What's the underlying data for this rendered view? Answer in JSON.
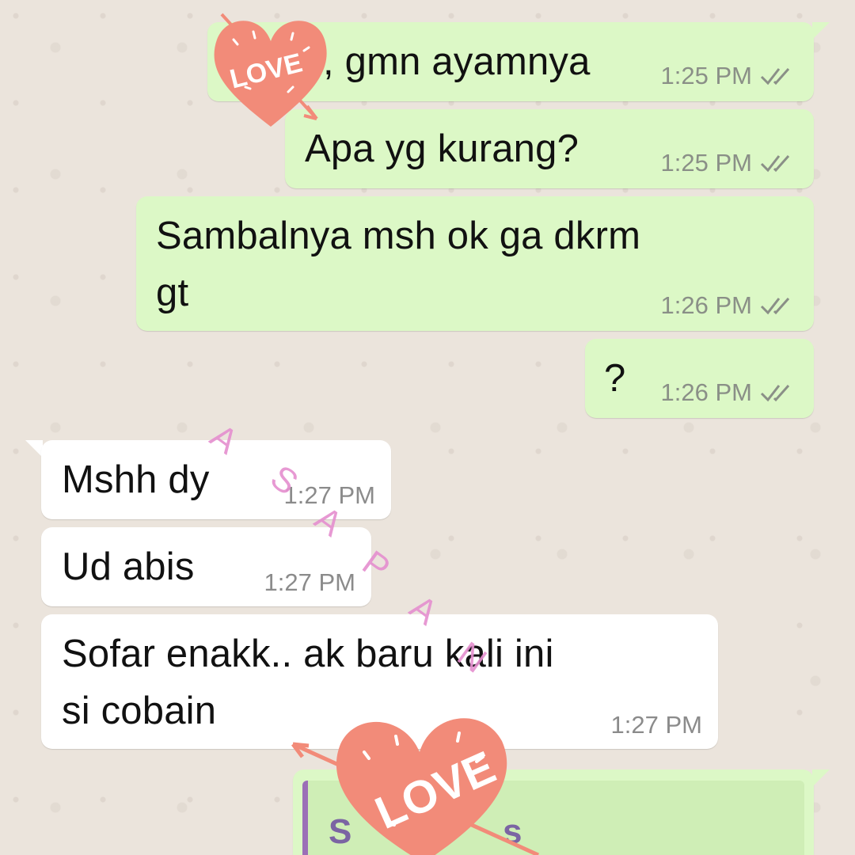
{
  "messages": [
    {
      "text": ", gmn ayamnya",
      "time": "1:25 PM",
      "direction": "outgoing",
      "ticks": "double-check-icon"
    },
    {
      "text": "Apa yg kurang?",
      "time": "1:25 PM",
      "direction": "outgoing",
      "ticks": "double-check-icon"
    },
    {
      "text_line1": "Sambalnya msh ok ga dkrm",
      "text_line2": "gt",
      "time": "1:26 PM",
      "direction": "outgoing",
      "ticks": "double-check-icon"
    },
    {
      "text": "?",
      "time": "1:26 PM",
      "direction": "outgoing",
      "ticks": "double-check-icon"
    },
    {
      "text": "Mshh dy",
      "time": "1:27 PM",
      "direction": "incoming"
    },
    {
      "text": "Ud abis",
      "time": "1:27 PM",
      "direction": "incoming"
    },
    {
      "text_line1": "Sofar enakk.. ak baru kali ini",
      "text_line2": "si cobain",
      "time": "1:27 PM",
      "direction": "incoming"
    }
  ],
  "quoted_partial": {
    "left": "S",
    "right": "s"
  },
  "stickers": [
    {
      "label": "LOVE",
      "icon": "heart-love-sticker-icon"
    },
    {
      "label": "LOVE",
      "icon": "heart-love-sticker-icon"
    }
  ],
  "watermark": [
    "A",
    "S",
    "A",
    "P",
    "A",
    "N"
  ],
  "colors": {
    "outgoing_bubble": "#dcf8c6",
    "incoming_bubble": "#ffffff",
    "heart": "#f28b79",
    "watermark": "#e58fcf",
    "tick": "#8a8f87"
  }
}
